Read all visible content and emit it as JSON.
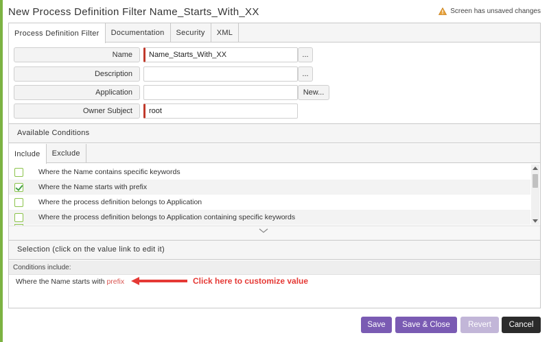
{
  "window": {
    "title": "New Process Definition Filter Name_Starts_With_XX",
    "unsaved_text": "Screen has unsaved changes",
    "warning_icon": "warning-icon"
  },
  "tabs": [
    {
      "label": "Process Definition Filter",
      "active": true
    },
    {
      "label": "Documentation",
      "active": false
    },
    {
      "label": "Security",
      "active": false
    },
    {
      "label": "XML",
      "active": false
    }
  ],
  "form": {
    "name_label": "Name",
    "name_value": "Name_Starts_With_XX",
    "name_btn": "...",
    "description_label": "Description",
    "description_value": "",
    "description_btn": "...",
    "application_label": "Application",
    "application_value": "",
    "application_btn": "New...",
    "owner_label": "Owner Subject",
    "owner_value": "root"
  },
  "available": {
    "title": "Available Conditions",
    "subtabs": [
      {
        "label": "Include",
        "active": true
      },
      {
        "label": "Exclude",
        "active": false
      }
    ],
    "items": [
      {
        "label": "Where the Name contains specific keywords",
        "checked": false
      },
      {
        "label": "Where the Name starts with prefix",
        "checked": true
      },
      {
        "label": "Where the process definition belongs to Application",
        "checked": false
      },
      {
        "label": "Where the process definition belongs to Application containing specific keywords",
        "checked": false
      }
    ]
  },
  "selection": {
    "title": "Selection (click on the value link to edit it)",
    "conditions_label": "Conditions include:",
    "line_prefix": "Where the Name starts with",
    "line_link": "prefix"
  },
  "annotation": {
    "text": "Click here to customize value",
    "color": "#e53935"
  },
  "buttons": {
    "save": "Save",
    "save_close": "Save & Close",
    "revert": "Revert",
    "cancel": "Cancel"
  },
  "colors": {
    "accent": "#7a5bb3",
    "required": "#c0392b",
    "checkbox": "#8bc34a",
    "link": "#d9534f",
    "left_bar": "#7cb342"
  }
}
